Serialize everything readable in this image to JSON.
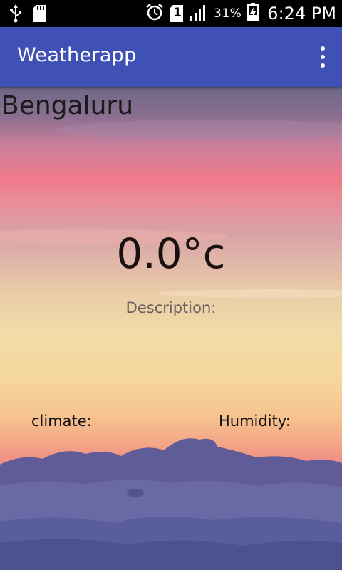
{
  "status_bar": {
    "battery_percent": "31%",
    "time": "6:24 PM",
    "sim_slot": "1",
    "icons": [
      "usb-icon",
      "sd-card-icon",
      "alarm-icon",
      "sim-icon",
      "signal-icon",
      "battery-charging-icon"
    ]
  },
  "app_bar": {
    "title": "Weatherapp",
    "menu_icon": "overflow-menu-icon",
    "color": "#3F51B5"
  },
  "weather": {
    "city": "Bengaluru",
    "temperature": "0.0°c",
    "description_label": "Description:",
    "climate_label": "climate:",
    "humidity_label": "Humidity:"
  }
}
